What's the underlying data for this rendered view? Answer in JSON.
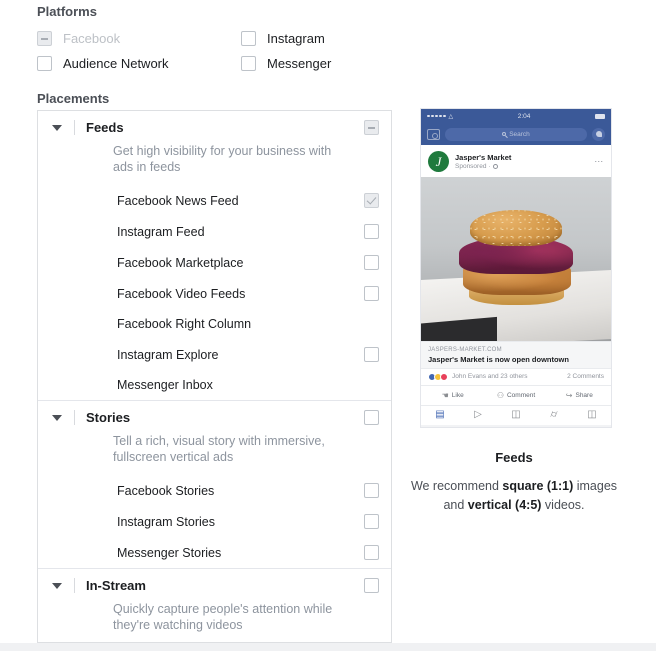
{
  "platforms": {
    "label": "Platforms",
    "items": [
      {
        "name": "Facebook",
        "state": "indeterminate",
        "disabled": true
      },
      {
        "name": "Instagram",
        "state": "unchecked",
        "disabled": false
      },
      {
        "name": "Audience Network",
        "state": "unchecked",
        "disabled": false
      },
      {
        "name": "Messenger",
        "state": "unchecked",
        "disabled": false
      }
    ]
  },
  "placements": {
    "label": "Placements",
    "groups": [
      {
        "title": "Feeds",
        "description": "Get high visibility for your business with ads in feeds",
        "state": "indeterminate",
        "expanded": true,
        "items": [
          {
            "name": "Facebook News Feed",
            "state": "checked",
            "disabled": true,
            "has_checkbox": true
          },
          {
            "name": "Instagram Feed",
            "state": "unchecked",
            "has_checkbox": true
          },
          {
            "name": "Facebook Marketplace",
            "state": "unchecked",
            "has_checkbox": true
          },
          {
            "name": "Facebook Video Feeds",
            "state": "unchecked",
            "has_checkbox": true
          },
          {
            "name": "Facebook Right Column",
            "has_checkbox": false
          },
          {
            "name": "Instagram Explore",
            "state": "unchecked",
            "has_checkbox": true
          },
          {
            "name": "Messenger Inbox",
            "has_checkbox": false
          }
        ]
      },
      {
        "title": "Stories",
        "description": "Tell a rich, visual story with immersive, fullscreen vertical ads",
        "state": "unchecked",
        "expanded": true,
        "items": [
          {
            "name": "Facebook Stories",
            "state": "unchecked",
            "has_checkbox": true
          },
          {
            "name": "Instagram Stories",
            "state": "unchecked",
            "has_checkbox": true
          },
          {
            "name": "Messenger Stories",
            "state": "unchecked",
            "has_checkbox": true
          }
        ]
      },
      {
        "title": "In-Stream",
        "description": "Quickly capture people's attention while they're watching videos",
        "state": "unchecked",
        "expanded": true,
        "items": []
      }
    ]
  },
  "preview": {
    "title": "Feeds",
    "recommendation": {
      "part1": "We recommend ",
      "bold1": "square (1:1)",
      "part2": " images and ",
      "bold2": "vertical (4:5)",
      "part3": " videos."
    },
    "phone": {
      "status_time": "2:04",
      "search_placeholder": "Search",
      "page_name": "Jasper's Market",
      "sponsored_label": "Sponsored",
      "link_domain": "JASPERS-MARKET.COM",
      "link_title": "Jasper's Market is now open downtown",
      "likes_text": "John Evans and 23 others",
      "comments_text": "2 Comments",
      "actions": [
        {
          "label": "Like",
          "glyph": "ὄD"
        },
        {
          "label": "Comment",
          "glyph": "□"
        },
        {
          "label": "Share",
          "glyph": "↪"
        }
      ],
      "tabs": [
        {
          "name": "news-feed",
          "glyph": "▤",
          "active": true
        },
        {
          "name": "video",
          "glyph": "▶",
          "active": false
        },
        {
          "name": "marketplace",
          "glyph": "☰",
          "active": false
        },
        {
          "name": "notifications",
          "glyph": "○",
          "active": false
        },
        {
          "name": "menu",
          "glyph": "≡",
          "active": false
        }
      ]
    }
  },
  "colors": {
    "facebook_blue": "#3b5998",
    "accent_blue": "#4267b2",
    "border": "#dddfe2",
    "muted_text": "#8d949e"
  }
}
